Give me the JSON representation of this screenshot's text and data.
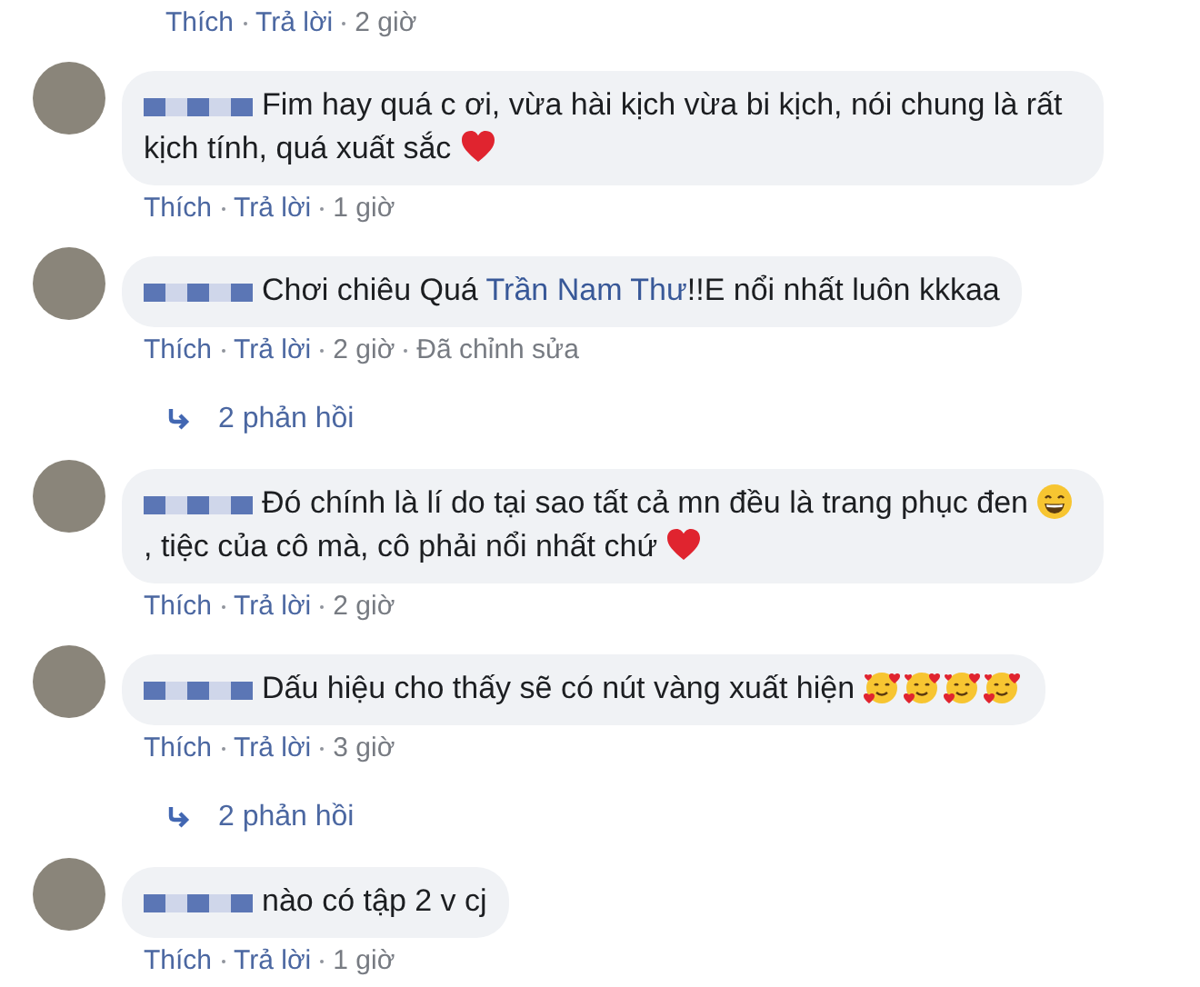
{
  "cut_top_actions": {
    "like": "Thích",
    "reply": "Trả lời",
    "time": "2 giờ"
  },
  "comments": [
    {
      "segments": [
        {
          "kind": "text",
          "text": "Fim hay quá c ơi, vừa hài kịch vừa bi kịch, nói chung là rất kịch tính, quá xuất sắc "
        },
        {
          "kind": "heart"
        }
      ],
      "like": "Thích",
      "reply": "Trả lời",
      "time": "1 giờ"
    },
    {
      "segments": [
        {
          "kind": "text",
          "text": "Chơi chiêu Quá "
        },
        {
          "kind": "mention",
          "text": "Trần Nam Thư"
        },
        {
          "kind": "text",
          "text": "!!E nổi nhất luôn kkkaa"
        }
      ],
      "like": "Thích",
      "reply": "Trả lời",
      "time": "2 giờ",
      "edited": "Đã chỉnh sửa",
      "replies": "2 phản hồi"
    },
    {
      "segments": [
        {
          "kind": "text",
          "text": "Đó chính là lí do tại sao tất cả mn đều là trang phục đen "
        },
        {
          "kind": "grin"
        },
        {
          "kind": "text",
          "text": ", tiệc của cô mà, cô phải nổi nhất chứ "
        },
        {
          "kind": "heart"
        }
      ],
      "like": "Thích",
      "reply": "Trả lời",
      "time": "2 giờ"
    },
    {
      "segments": [
        {
          "kind": "text",
          "text": "Dấu hiệu cho thấy sẽ có nút vàng xuất hiện "
        },
        {
          "kind": "love"
        },
        {
          "kind": "love"
        },
        {
          "kind": "love"
        },
        {
          "kind": "love"
        }
      ],
      "like": "Thích",
      "reply": "Trả lời",
      "time": "3 giờ",
      "replies": "2 phản hồi"
    },
    {
      "segments": [
        {
          "kind": "text",
          "text": "nào có tập 2 v cj"
        }
      ],
      "like": "Thích",
      "reply": "Trả lời",
      "time": "1 giờ"
    }
  ]
}
